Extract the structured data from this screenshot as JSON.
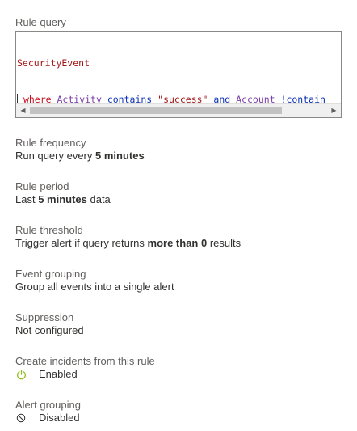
{
  "rule_query": {
    "label": "Rule query",
    "line1": "SecurityEvent",
    "line2": {
      "keyword": "where",
      "column1": "Activity",
      "op1": "contains",
      "string1": "\"success\"",
      "and": "and",
      "column2": "Account",
      "op2": "!contain"
    }
  },
  "rule_frequency": {
    "label": "Rule frequency",
    "prefix": "Run query every ",
    "bold": "5 minutes"
  },
  "rule_period": {
    "label": "Rule period",
    "prefix": "Last ",
    "bold": "5 minutes",
    "suffix": " data"
  },
  "rule_threshold": {
    "label": "Rule threshold",
    "prefix": "Trigger alert if query returns ",
    "bold": "more than 0",
    "suffix": " results"
  },
  "event_grouping": {
    "label": "Event grouping",
    "value": "Group all events into a single alert"
  },
  "suppression": {
    "label": "Suppression",
    "value": "Not configured"
  },
  "create_incidents": {
    "label": "Create incidents from this rule",
    "value": "Enabled",
    "icon": "power-icon",
    "icon_color": "#8cbd18"
  },
  "alert_grouping": {
    "label": "Alert grouping",
    "value": "Disabled",
    "icon": "blocked-icon",
    "icon_color": "#323130"
  }
}
